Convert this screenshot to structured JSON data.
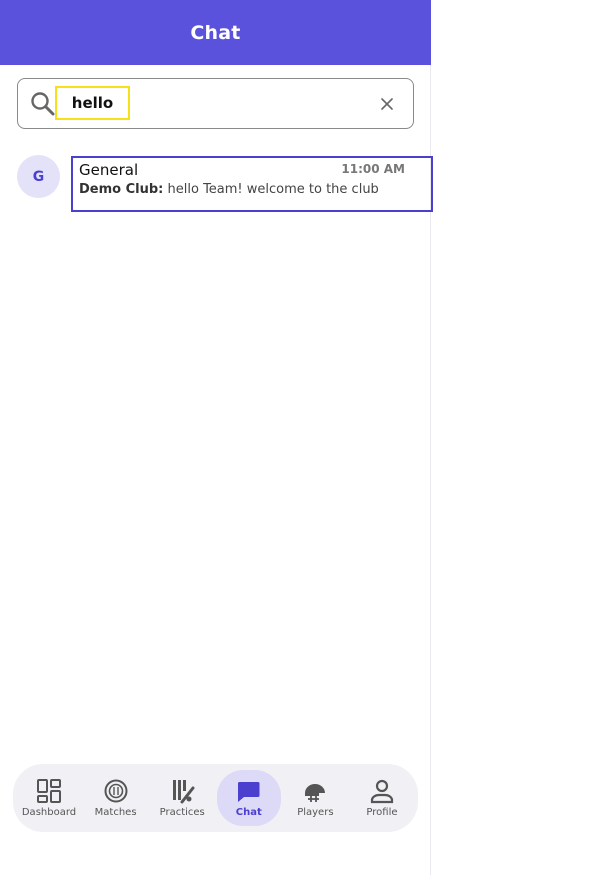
{
  "colors": {
    "header_bg": "#5a52dd",
    "accent": "#4b3fd0",
    "avatar_bg": "#e4e2f8",
    "tab_bar_bg": "#f1f1f5",
    "active_tab_bg": "#dcdaf6",
    "highlight_box": "#f5e01a"
  },
  "header": {
    "title": "Chat"
  },
  "search": {
    "value": "hello",
    "icon": "search-icon",
    "clear_icon": "close-icon"
  },
  "chats": [
    {
      "avatar_letter": "G",
      "name": "General",
      "time": "11:00 AM",
      "sender": "Demo Club:",
      "message": "hello Team! welcome to the club"
    }
  ],
  "tabs": [
    {
      "label": "Dashboard",
      "icon": "dashboard-icon",
      "active": false
    },
    {
      "label": "Matches",
      "icon": "ball-icon",
      "active": false
    },
    {
      "label": "Practices",
      "icon": "cricket-bat-icon",
      "active": false
    },
    {
      "label": "Chat",
      "icon": "chat-bubble-icon",
      "active": true
    },
    {
      "label": "Players",
      "icon": "helmet-icon",
      "active": false
    },
    {
      "label": "Profile",
      "icon": "person-icon",
      "active": false
    }
  ]
}
